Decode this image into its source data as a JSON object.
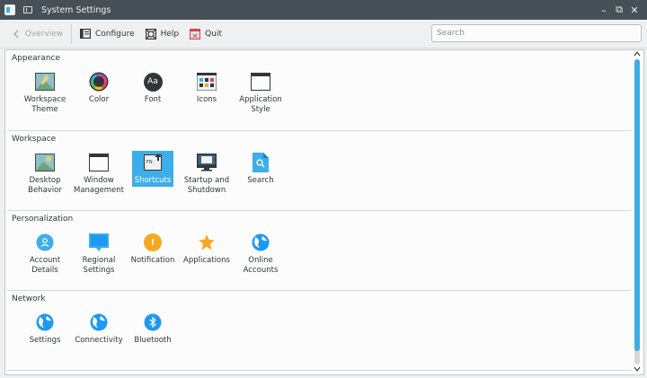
{
  "window": {
    "title": "System Settings",
    "controls": {
      "minimize": "–",
      "maximize": "⧉",
      "close": "✕"
    }
  },
  "toolbar": {
    "overview_label": "Overview",
    "configure_label": "Configure",
    "help_label": "Help",
    "quit_label": "Quit"
  },
  "search": {
    "placeholder": "Search"
  },
  "sections": [
    {
      "title": "Appearance",
      "items": [
        {
          "label": "Workspace\nTheme",
          "icon": "workspace-theme-icon"
        },
        {
          "label": "Color",
          "icon": "color-icon"
        },
        {
          "label": "Font",
          "icon": "font-icon",
          "glyph": "Aa"
        },
        {
          "label": "Icons",
          "icon": "icons-icon"
        },
        {
          "label": "Application\nStyle",
          "icon": "application-style-icon"
        }
      ]
    },
    {
      "title": "Workspace",
      "items": [
        {
          "label": "Desktop\nBehavior",
          "icon": "desktop-behavior-icon"
        },
        {
          "label": "Window\nManagement",
          "icon": "window-management-icon"
        },
        {
          "label": "Shortcuts",
          "icon": "shortcuts-icon",
          "glyph": "FN",
          "selected": true
        },
        {
          "label": "Startup and\nShutdown",
          "icon": "startup-shutdown-icon"
        },
        {
          "label": "Search",
          "icon": "search-icon"
        }
      ]
    },
    {
      "title": "Personalization",
      "items": [
        {
          "label": "Account\nDetails",
          "icon": "account-details-icon"
        },
        {
          "label": "Regional\nSettings",
          "icon": "regional-settings-icon"
        },
        {
          "label": "Notification",
          "icon": "notification-icon",
          "glyph": "!"
        },
        {
          "label": "Applications",
          "icon": "applications-icon"
        },
        {
          "label": "Online\nAccounts",
          "icon": "online-accounts-icon"
        }
      ]
    },
    {
      "title": "Network",
      "items": [
        {
          "label": "Settings",
          "icon": "network-settings-icon"
        },
        {
          "label": "Connectivity",
          "icon": "connectivity-icon"
        },
        {
          "label": "Bluetooth",
          "icon": "bluetooth-icon"
        }
      ]
    }
  ],
  "colors": {
    "accent": "#3daee9",
    "titlebar": "#475057",
    "window_bg": "#eff0f1",
    "content_bg": "#fcfcfc",
    "notification": "#f6a823",
    "applications_star": "#f6a823"
  }
}
